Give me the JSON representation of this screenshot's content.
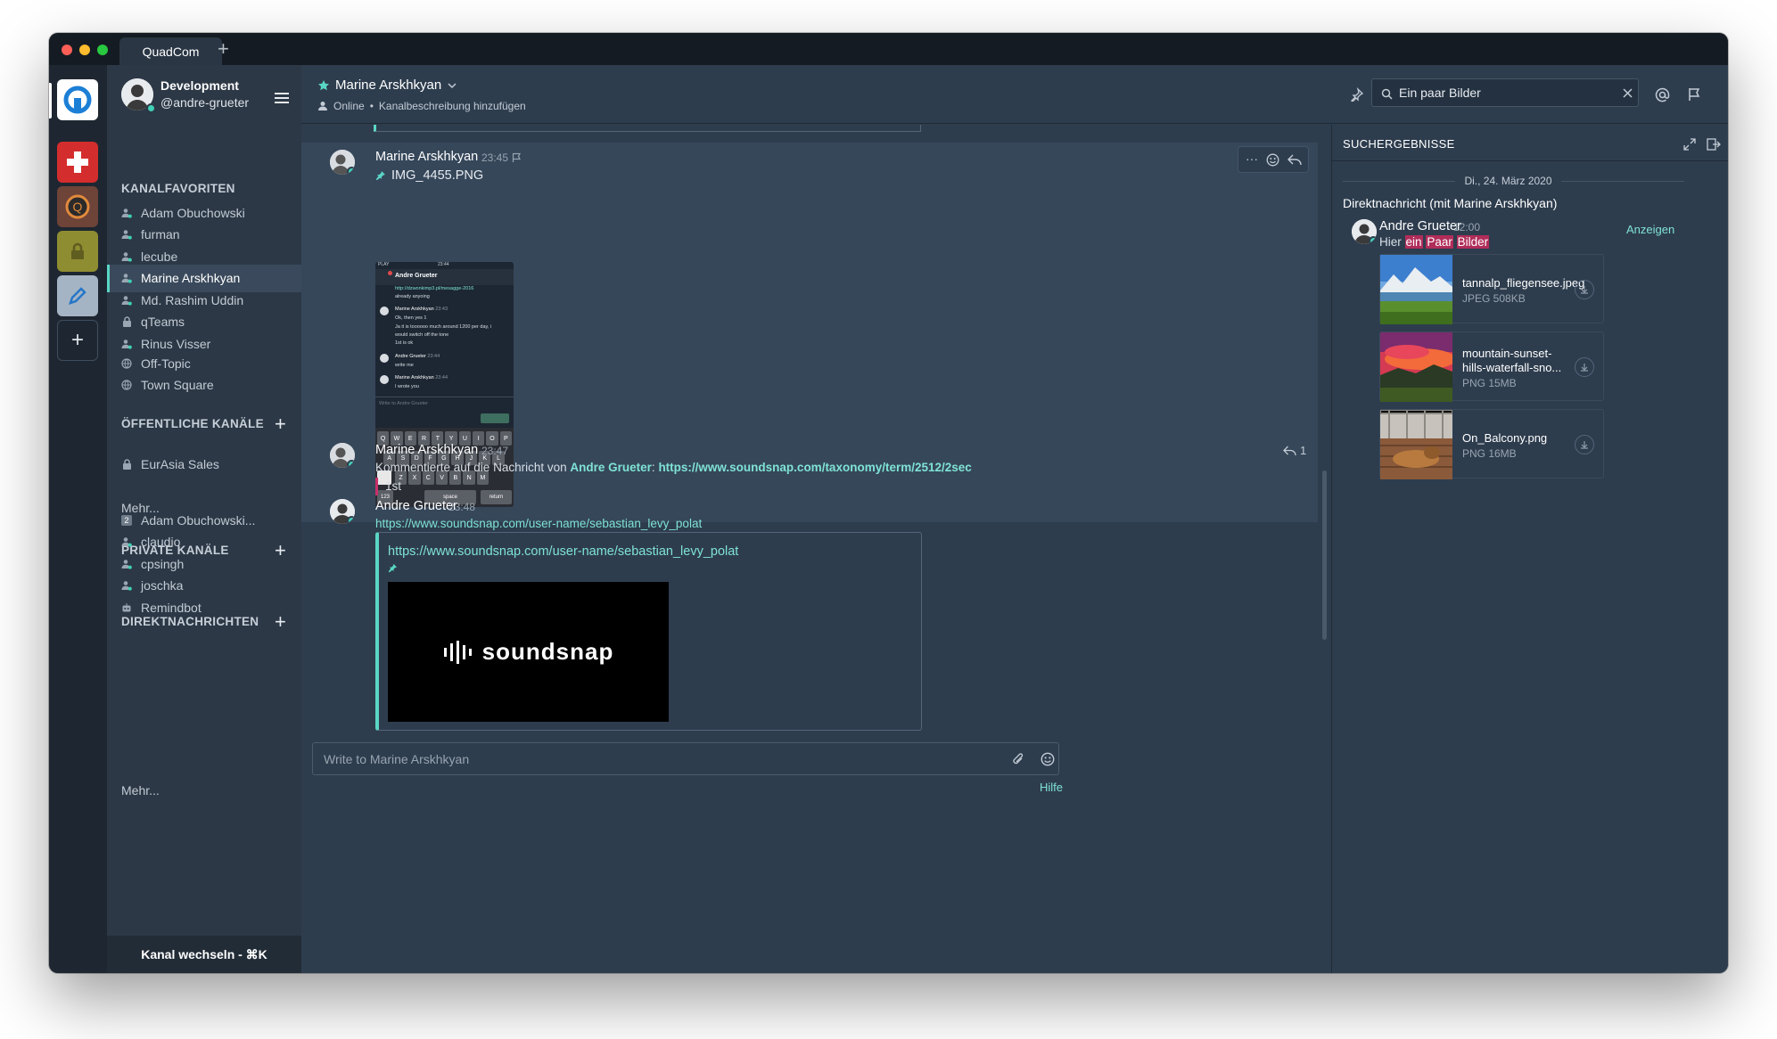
{
  "app": {
    "tab_title": "QuadCom",
    "new_tab": "+"
  },
  "profile": {
    "team": "Development",
    "handle": "@andre-grueter"
  },
  "sidebar": {
    "favorites_title": "KANALFAVORITEN",
    "favorites": [
      {
        "label": "Adam Obuchowski",
        "icon": "user-icon"
      },
      {
        "label": "furman",
        "icon": "user-icon"
      },
      {
        "label": "lecube",
        "icon": "user-icon"
      },
      {
        "label": "Marine Arskhkyan",
        "icon": "user-icon",
        "active": true
      },
      {
        "label": "Md. Rashim Uddin",
        "icon": "user-icon"
      },
      {
        "label": "qTeams",
        "icon": "lock-icon"
      },
      {
        "label": "Rinus Visser",
        "icon": "user-icon"
      }
    ],
    "public_title": "ÖFFENTLICHE KANÄLE",
    "public": [
      {
        "label": "Off-Topic",
        "icon": "globe-icon"
      },
      {
        "label": "Town Square",
        "icon": "globe-icon"
      }
    ],
    "public_more": "Mehr...",
    "private_title": "PRIVATE KANÄLE",
    "private": [
      {
        "label": "EurAsia Sales",
        "icon": "lock-icon"
      }
    ],
    "dm_title": "DIREKTNACHRICHTEN",
    "dms": [
      {
        "label": "Adam Obuchowski...",
        "icon": "group-badge",
        "badge": "2"
      },
      {
        "label": "claudio",
        "icon": "user-icon"
      },
      {
        "label": "cpsingh",
        "icon": "user-icon"
      },
      {
        "label": "joschka",
        "icon": "user-icon"
      },
      {
        "label": "Remindbot",
        "icon": "bot-icon"
      }
    ],
    "dm_more": "Mehr...",
    "switcher": "Kanal wechseln - ⌘K"
  },
  "header": {
    "channel": "Marine Arskhkyan",
    "status": "Online",
    "separator": "•",
    "description": "Kanalbeschreibung hinzufügen",
    "search_value": "Ein paar Bilder"
  },
  "posts": {
    "p1": {
      "user": "Marine Arskhkyan",
      "time": "23:45",
      "file": "IMG_4455.PNG"
    },
    "p2": {
      "user": "Marine Arskhkyan",
      "time": "23:47",
      "comment_prefix": "Kommentierte auf die Nachricht von",
      "comment_user": "Andre Grueter",
      "comment_sep": ":",
      "comment_link": "https://www.soundsnap.com/taxonomy/term/2512/2sec",
      "reply_count": "1",
      "quote": "1st"
    },
    "p3": {
      "user": "Andre Grueter",
      "time": "23:48",
      "link": "https://www.soundsnap.com/user-name/sebastian_levy_polat",
      "card_url": "https://www.soundsnap.com/user-name/sebastian_levy_polat",
      "brand": "soundsnap"
    }
  },
  "thumb": {
    "status_left": "PLAY",
    "status_time": "23:44",
    "title": "Andre Grueter",
    "link_line": "http://dzwonkimp3.pl/mesagge-2016",
    "line_already": "already anyoing",
    "m1_user": "Marine Arskhkyan",
    "m1_time": "23:43",
    "m1_text1": "Ok, then yes 1",
    "m1_text2": "Ja it is toooooo much around 1200 per day, i",
    "m1_text3": "would switch off the tone",
    "m1_text4": "1st is ok",
    "m2_user": "Andre Grueter",
    "m2_time": "23:44",
    "m2_text": "write me",
    "m3_user": "Marine Arskhkyan",
    "m3_time": "23:44",
    "m3_text": "I wrote you",
    "input_placeholder": "Write to Andre Grueter",
    "keys_row1": [
      "Q",
      "W",
      "E",
      "R",
      "T",
      "Y",
      "U",
      "I",
      "O",
      "P"
    ],
    "keys_row2": [
      "A",
      "S",
      "D",
      "F",
      "G",
      "H",
      "J",
      "K",
      "L"
    ],
    "keys_row3": [
      "Z",
      "X",
      "C",
      "V",
      "B",
      "N",
      "M"
    ],
    "key_123": "123",
    "key_space": "space",
    "key_return": "return"
  },
  "composer": {
    "placeholder": "Write to Marine Arskhkyan",
    "help": "Hilfe"
  },
  "rhs": {
    "title": "SUCHERGEBNISSE",
    "date": "Di., 24. März 2020",
    "context": "Direktnachricht (mit Marine Arskhkyan)",
    "result_user": "Andre Grueter",
    "result_time": "12:00",
    "jump": "Anzeigen",
    "text_prefix": "Hier",
    "hl1": "ein",
    "hl2": "Paar",
    "hl3": "Bilder",
    "files": [
      {
        "name": "tannalp_fliegensee.jpeg",
        "meta": "JPEG 508KB"
      },
      {
        "name": "mountain-sunset-hills-waterfall-sno...",
        "meta": "PNG 15MB"
      },
      {
        "name": "On_Balcony.png",
        "meta": "PNG 16MB"
      }
    ]
  },
  "colors": {
    "accent": "#5ad6c5",
    "highlight": "#b02d5a",
    "online": "#3fd0b5",
    "sidebar": "#2c3846",
    "center": "#2e3d4e"
  }
}
